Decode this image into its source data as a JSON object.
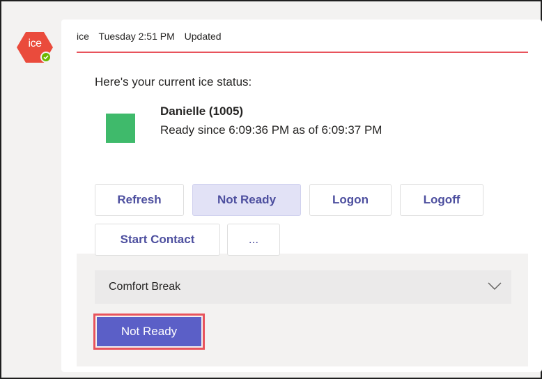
{
  "bot": {
    "avatar_text": "ice"
  },
  "message": {
    "sender": "ice",
    "time": "Tuesday 2:51 PM",
    "edited": "Updated"
  },
  "card": {
    "intro": "Here's your current ice status:",
    "agent_name": "Danielle (1005)",
    "status_text": "Ready since 6:09:36 PM as of 6:09:37 PM",
    "status_color": "#3fba6b",
    "buttons": {
      "refresh": "Refresh",
      "not_ready": "Not Ready",
      "logon": "Logon",
      "logoff": "Logoff",
      "start_contact": "Start Contact",
      "more": "..."
    },
    "reason_select": {
      "value": "Comfort Break"
    },
    "submit_label": "Not Ready"
  },
  "colors": {
    "accent": "#5b5fc7",
    "highlight_border": "#e8535c",
    "brand_red": "#e8535c",
    "presence_available": "#6bb700"
  }
}
